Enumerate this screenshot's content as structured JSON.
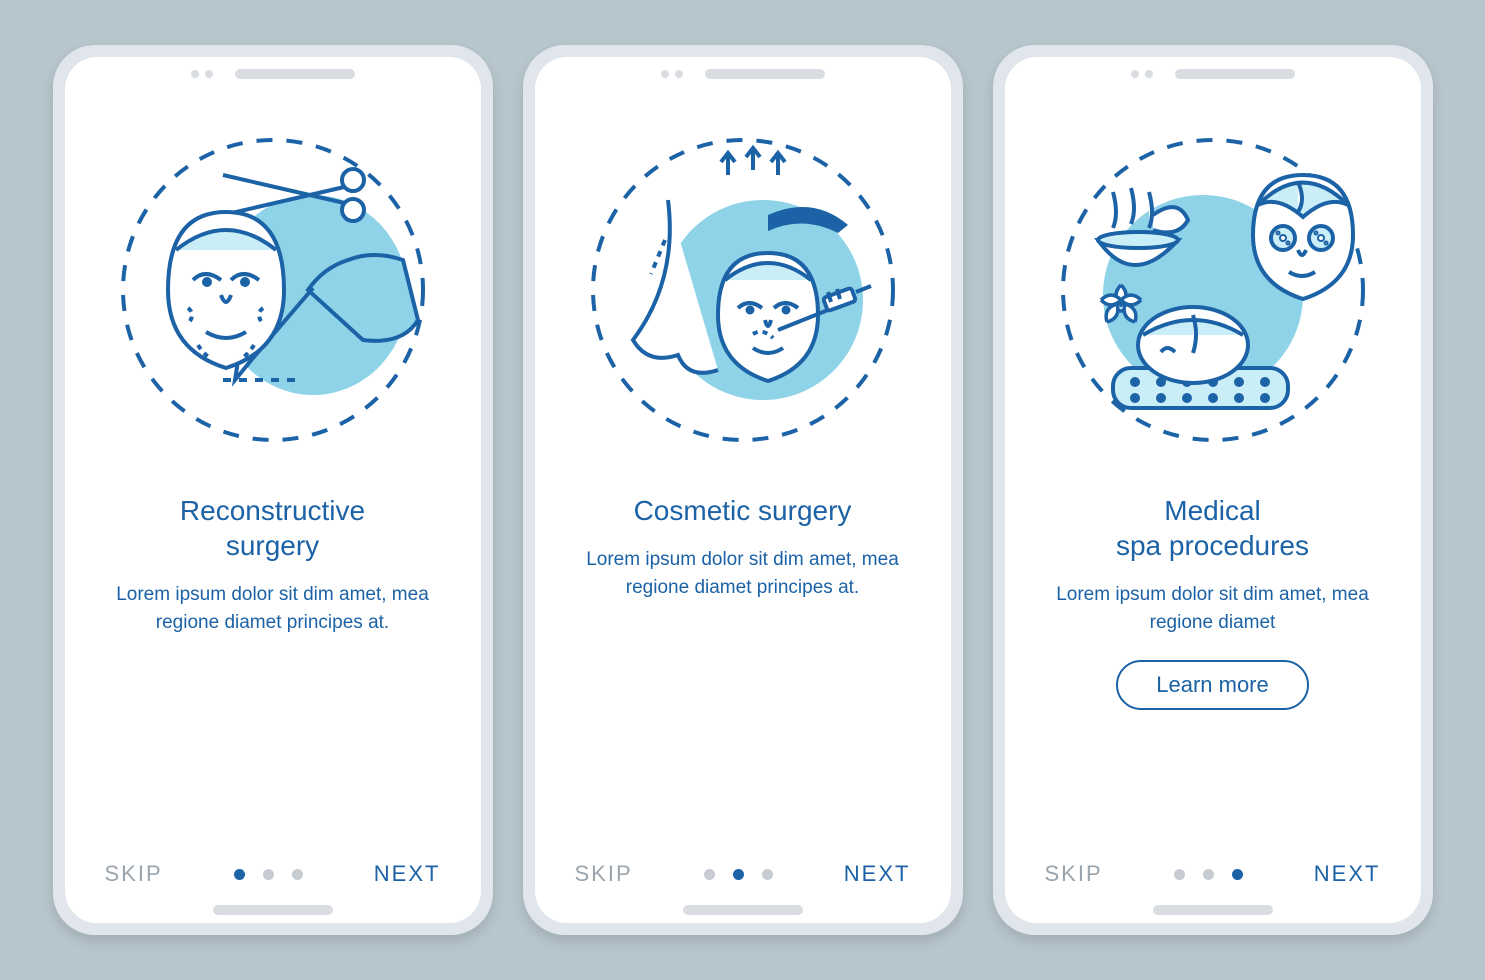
{
  "colors": {
    "accent": "#1b62a6",
    "illus_fill": "#8fd3e8",
    "illus_light": "#c9eef7",
    "background": "#b7c5cd",
    "phone_shell": "#e0e6eb",
    "muted": "#9aa4ad",
    "dot_inactive": "#c6ccd2"
  },
  "screens": [
    {
      "icon": "reconstructive-surgery-icon",
      "title": "Reconstructive\nsurgery",
      "desc": "Lorem ipsum dolor sit dim amet, mea regione diamet principes at.",
      "skip_label": "SKIP",
      "next_label": "NEXT",
      "active_dot": 0,
      "cta": null
    },
    {
      "icon": "cosmetic-surgery-icon",
      "title": "Cosmetic surgery",
      "desc": "Lorem ipsum dolor sit dim amet, mea regione diamet principes at.",
      "skip_label": "SKIP",
      "next_label": "NEXT",
      "active_dot": 1,
      "cta": null
    },
    {
      "icon": "medical-spa-icon",
      "title": "Medical\nspa procedures",
      "desc": "Lorem ipsum dolor sit dim amet, mea regione diamet",
      "skip_label": "SKIP",
      "next_label": "NEXT",
      "active_dot": 2,
      "cta": "Learn more"
    }
  ],
  "dot_count": 3
}
